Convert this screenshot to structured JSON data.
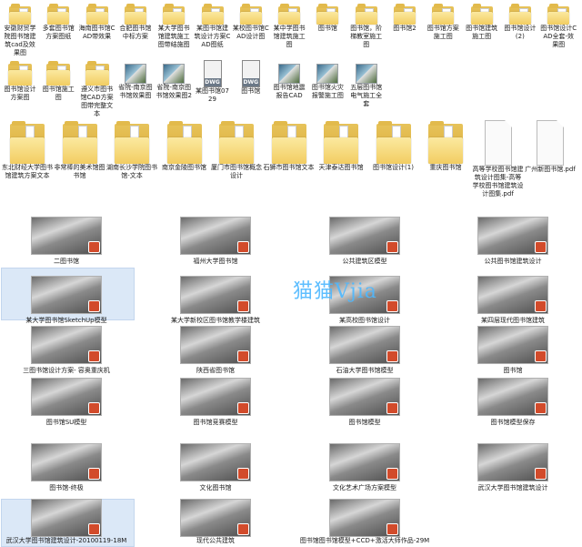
{
  "row1": [
    "安徽财贸学院图书馆建筑cad及效果图",
    "多套图书馆方案图纸",
    "海南图书馆CAD带效果",
    "合肥图书馆中标方案",
    "某大学图书馆建筑施工图带结施图",
    "某图书馆建筑设计方案CAD图纸",
    "某校图书馆CAD设计图",
    "某中学图书馆建筑施工图",
    "图书馆",
    "图书馆，阶梯教室施工图",
    "图书馆2",
    "图书馆方案施工图",
    "图书馆建筑施工图",
    "图书馆设计(2)",
    "图书馆设计CAD全套-效果图"
  ],
  "row2": [
    {
      "label": "图书馆设计方案图",
      "kind": "folder"
    },
    {
      "label": "图书馆施工图",
      "kind": "folder"
    },
    {
      "label": "遵义市图书馆CAD方案图带完整文本",
      "kind": "folder"
    },
    {
      "label": "省院-南京图书馆效果图",
      "kind": "image"
    },
    {
      "label": "省院-南京图书馆效果图2",
      "kind": "image"
    },
    {
      "label": "某图书馆0729",
      "kind": "dwg"
    },
    {
      "label": "图书馆",
      "kind": "dwg"
    },
    {
      "label": "图书馆地震报告CAD",
      "kind": "image"
    },
    {
      "label": "图书馆火灾报警施工图",
      "kind": "image"
    },
    {
      "label": "五层图书馆电气施工全套",
      "kind": "image"
    }
  ],
  "dwg_badge": "DWG",
  "row3": [
    {
      "label": "东北财经大学图书馆建筑方案文本",
      "kind": "folder"
    },
    {
      "label": "非常棒的美术馆图书馆",
      "kind": "folder"
    },
    {
      "label": "湖南长沙学院图书馆-文本",
      "kind": "folder"
    },
    {
      "label": "南京金陵图书馆",
      "kind": "folder"
    },
    {
      "label": "厦门市图书馆概念设计",
      "kind": "folder"
    },
    {
      "label": "石狮市图书馆文本",
      "kind": "folder"
    },
    {
      "label": "天津泰达图书馆",
      "kind": "folder"
    },
    {
      "label": "图书馆设计(1)",
      "kind": "folder"
    },
    {
      "label": "重庆图书馆",
      "kind": "folder"
    },
    {
      "label": "高等学校图书馆建筑设计图集-高等学校图书馆建筑设计图集.pdf",
      "kind": "doc"
    },
    {
      "label": "广州新图书馆.pdf",
      "kind": "doc"
    }
  ],
  "models": [
    [
      "二图书馆",
      "福州大学图书馆",
      "公共建筑区模型",
      "公共图书馆建筑设计"
    ],
    [
      "某大学图书馆SketchUp模型",
      "某大学新校区图书馆教学楼建筑",
      "某高校图书馆设计",
      "某四层现代图书馆建筑"
    ],
    [
      "三图书馆设计方案- 容奥重庆机",
      "陕西省图书馆",
      "石油大学图书馆模型",
      "图书馆"
    ],
    [
      "图书馆SU模型",
      "图书馆竞赛模型",
      "图书馆模型",
      "图书馆模型保存"
    ],
    [
      "图书馆-终极",
      "文化图书馆",
      "文化艺术广场方案模型",
      "武汉大学图书馆建筑设计"
    ],
    [
      "武汉大学图书馆建筑设计-20100119-18M",
      "现代公共建筑",
      "图书馆图书馆模型+CCD+激活大师作品-29M",
      ""
    ]
  ],
  "watermark": "猫猫Vjia"
}
